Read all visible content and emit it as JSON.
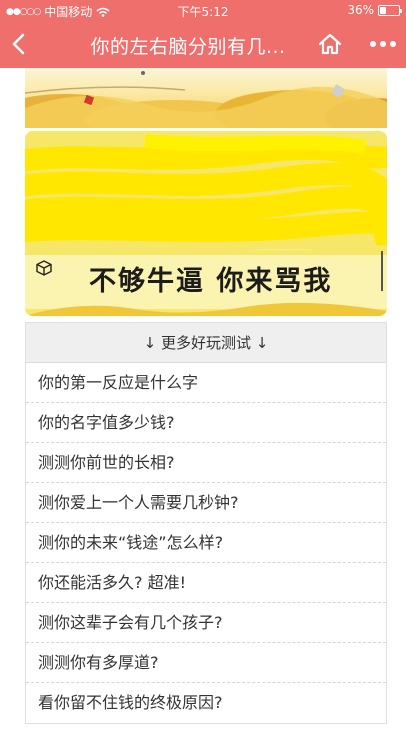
{
  "status_bar": {
    "carrier": "中国移动",
    "time": "下午5:12",
    "battery": "36%",
    "battery_level": 0.36
  },
  "nav": {
    "title": "你的左右脑分别有几...",
    "back_icon": "chevron-left-icon",
    "home_icon": "home-icon",
    "more_icon": "more-dots-icon"
  },
  "ad": {
    "slogan": "不够牛逼 你来骂我"
  },
  "more_tests": {
    "header": "↓ 更多好玩测试 ↓",
    "items": [
      "你的第一反应是什么字",
      "你的名字值多少钱?",
      "测测你前世的长相?",
      "测你爱上一个人需要几秒钟?",
      "测你的未来“钱途”怎么样?",
      "你还能活多久? 超准!",
      "测你这辈子会有几个孩子?",
      "测测你有多厚道?",
      "看你留不住钱的终极原因?"
    ]
  },
  "colors": {
    "header_bg": "#ef6f6c",
    "ad_bg": "#f7e65a",
    "list_header_bg": "#efefef"
  }
}
